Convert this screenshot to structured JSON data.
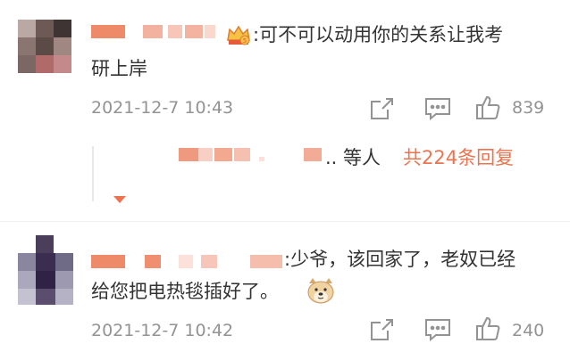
{
  "comments": [
    {
      "text_line1": ":可不可以动用你的关系让我考",
      "text_line2": "研上岸",
      "timestamp": "2021-12-7 10:43",
      "like_count": "839",
      "badge_icon": "crown-badge-icon",
      "replies_summary": {
        "suffix": ".. 等人",
        "link": "共224条回复"
      }
    },
    {
      "text_line1": ":少爷，该回家了，老奴已经",
      "text_line2": "给您把电热毯插好了。",
      "timestamp": "2021-12-7 10:42",
      "like_count": "240",
      "emoji_icon": "doge-emoji-icon"
    }
  ],
  "colors": {
    "accent": "#eb7350",
    "username_blur": "#f0a58f",
    "meta": "#939393",
    "text": "#333333"
  },
  "icons": [
    "share-icon",
    "comment-icon",
    "like-icon",
    "expand-triangle-icon"
  ]
}
